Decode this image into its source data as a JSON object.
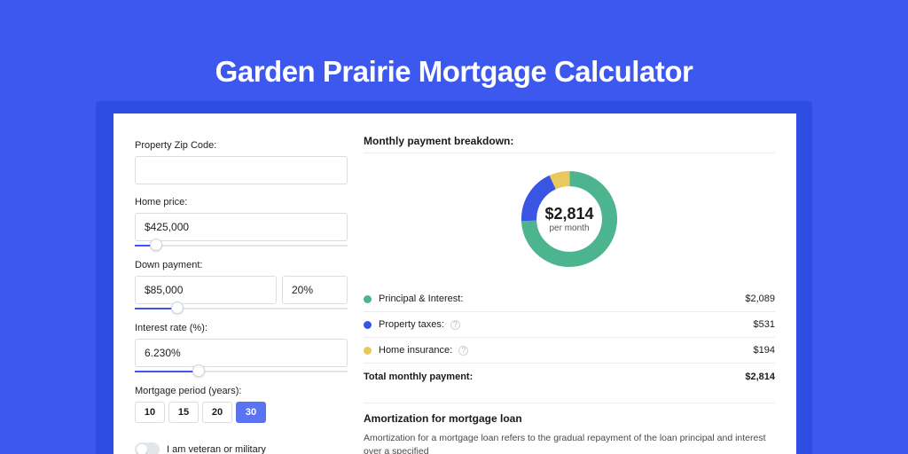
{
  "header": {
    "title": "Garden Prairie Mortgage Calculator"
  },
  "form": {
    "zip": {
      "label": "Property Zip Code:",
      "value": ""
    },
    "home_price": {
      "label": "Home price:",
      "value": "$425,000",
      "slider_pct": 10
    },
    "down_payment": {
      "label": "Down payment:",
      "amount": "$85,000",
      "percent": "20%",
      "slider_pct": 20
    },
    "interest": {
      "label": "Interest rate (%):",
      "value": "6.230%",
      "slider_pct": 30
    },
    "period": {
      "label": "Mortgage period (years):",
      "options": [
        "10",
        "15",
        "20",
        "30"
      ],
      "selected": "30"
    },
    "veteran": {
      "label": "I am veteran or military",
      "on": false
    }
  },
  "breakdown": {
    "title": "Monthly payment breakdown:",
    "center_amount": "$2,814",
    "center_sub": "per month",
    "items": [
      {
        "label": "Principal & Interest:",
        "value": "$2,089",
        "color": "#4cb58f",
        "info": false
      },
      {
        "label": "Property taxes:",
        "value": "$531",
        "color": "#3a55e4",
        "info": true
      },
      {
        "label": "Home insurance:",
        "value": "$194",
        "color": "#e9c85d",
        "info": true
      }
    ],
    "total": {
      "label": "Total monthly payment:",
      "value": "$2,814"
    }
  },
  "amort": {
    "title": "Amortization for mortgage loan",
    "text": "Amortization for a mortgage loan refers to the gradual repayment of the loan principal and interest over a specified"
  },
  "chart_data": {
    "type": "pie",
    "title": "Monthly payment breakdown",
    "series": [
      {
        "name": "Principal & Interest",
        "value": 2089,
        "color": "#4cb58f"
      },
      {
        "name": "Property taxes",
        "value": 531,
        "color": "#3a55e4"
      },
      {
        "name": "Home insurance",
        "value": 194,
        "color": "#e9c85d"
      }
    ],
    "total": 2814,
    "center_label": "$2,814 per month"
  }
}
